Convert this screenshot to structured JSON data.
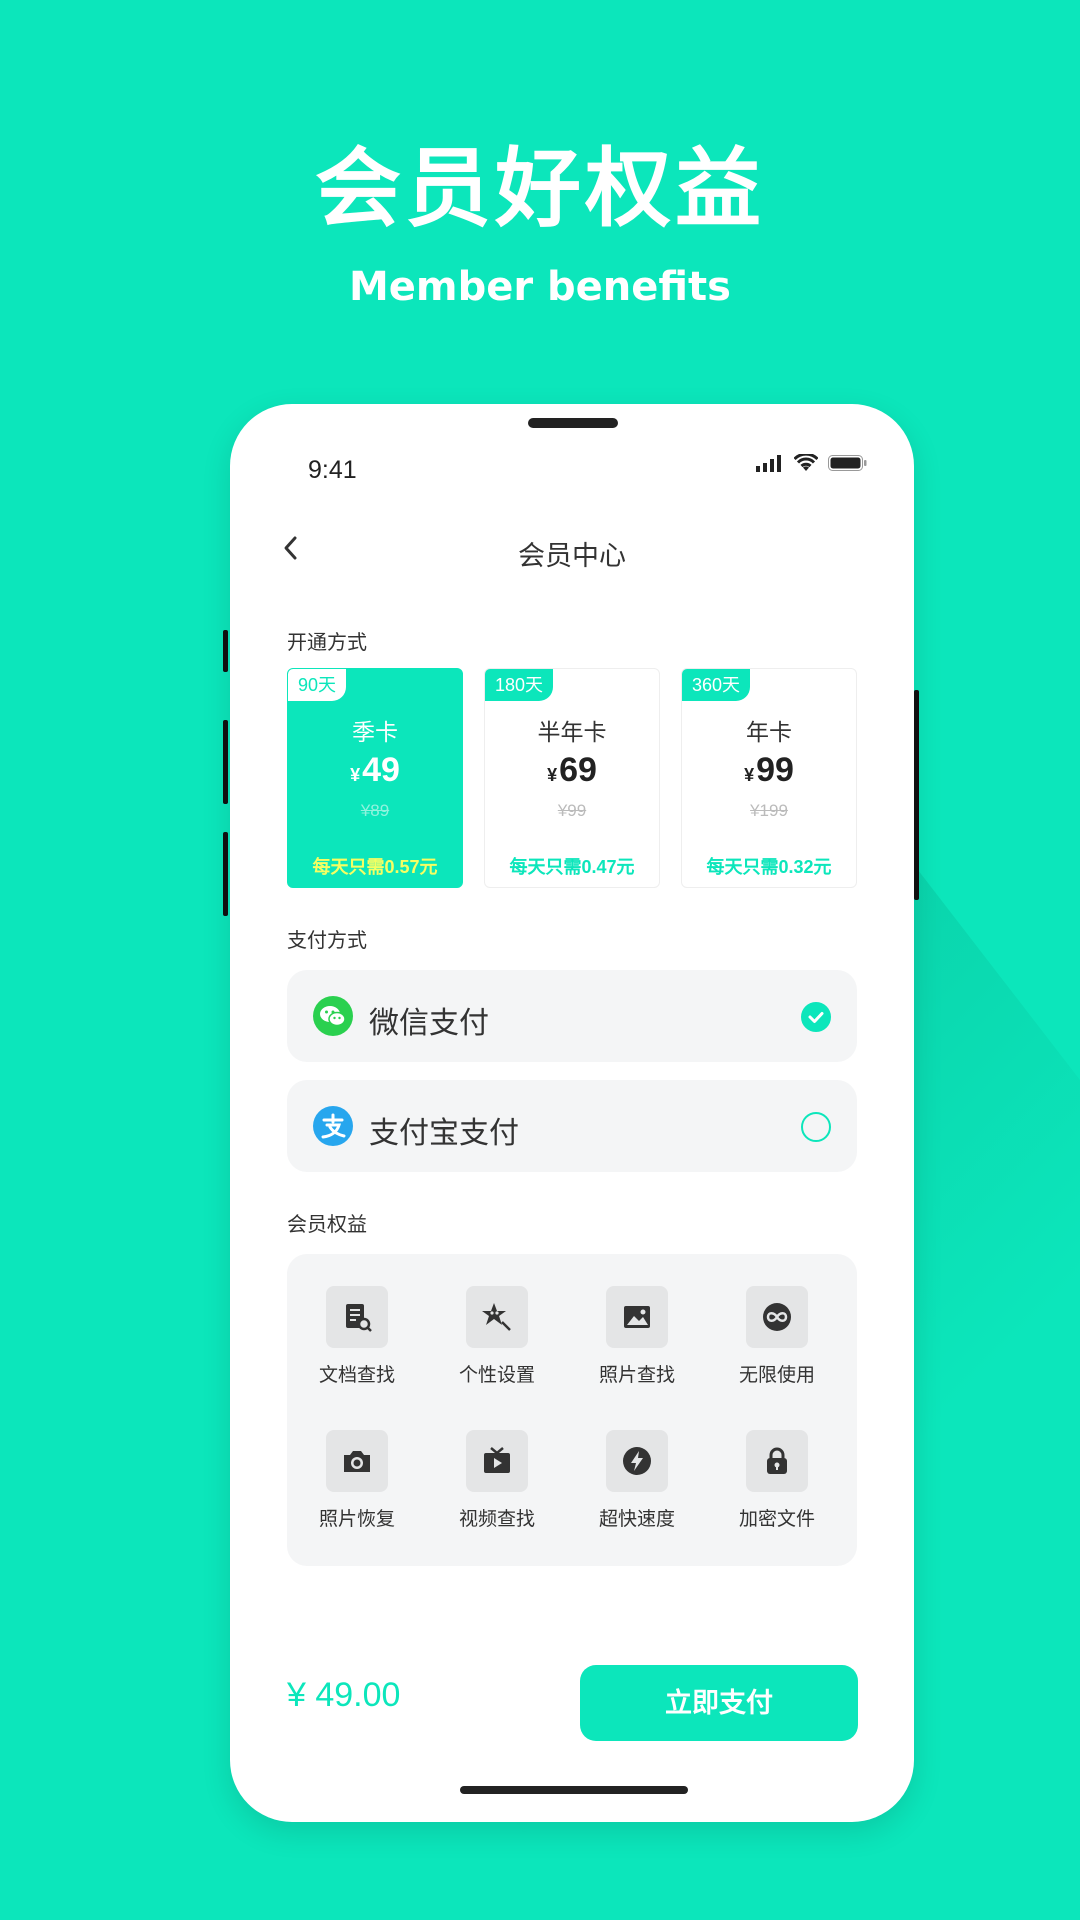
{
  "hero": {
    "title": "会员好权益",
    "subtitle": "Member benefits"
  },
  "status": {
    "time": "9:41"
  },
  "nav": {
    "title": "会员中心"
  },
  "sections": {
    "plans": "开通方式",
    "payment": "支付方式",
    "benefits": "会员权益"
  },
  "plans": [
    {
      "tag": "90天",
      "name": "季卡",
      "currency": "¥",
      "price": "49",
      "original": "¥89",
      "daily": "每天只需0.57元",
      "selected": true
    },
    {
      "tag": "180天",
      "name": "半年卡",
      "currency": "¥",
      "price": "69",
      "original": "¥99",
      "daily": "每天只需0.47元",
      "selected": false
    },
    {
      "tag": "360天",
      "name": "年卡",
      "currency": "¥",
      "price": "99",
      "original": "¥199",
      "daily": "每天只需0.32元",
      "selected": false
    }
  ],
  "payments": [
    {
      "label": "微信支付",
      "icon": "wechat-pay-icon",
      "selected": true
    },
    {
      "label": "支付宝支付",
      "icon": "alipay-icon",
      "selected": false
    }
  ],
  "benefits": [
    {
      "label": "文档查找",
      "icon": "document-search-icon"
    },
    {
      "label": "个性设置",
      "icon": "personalize-icon"
    },
    {
      "label": "照片查找",
      "icon": "image-icon"
    },
    {
      "label": "无限使用",
      "icon": "infinity-icon"
    },
    {
      "label": "照片恢复",
      "icon": "camera-icon"
    },
    {
      "label": "视频查找",
      "icon": "tv-icon"
    },
    {
      "label": "超快速度",
      "icon": "lightning-icon"
    },
    {
      "label": "加密文件",
      "icon": "lock-icon"
    }
  ],
  "footer": {
    "total": "¥ 49.00",
    "pay_button": "立即支付"
  },
  "colors": {
    "accent": "#0ce6bb",
    "highlight": "#f6ff62"
  }
}
